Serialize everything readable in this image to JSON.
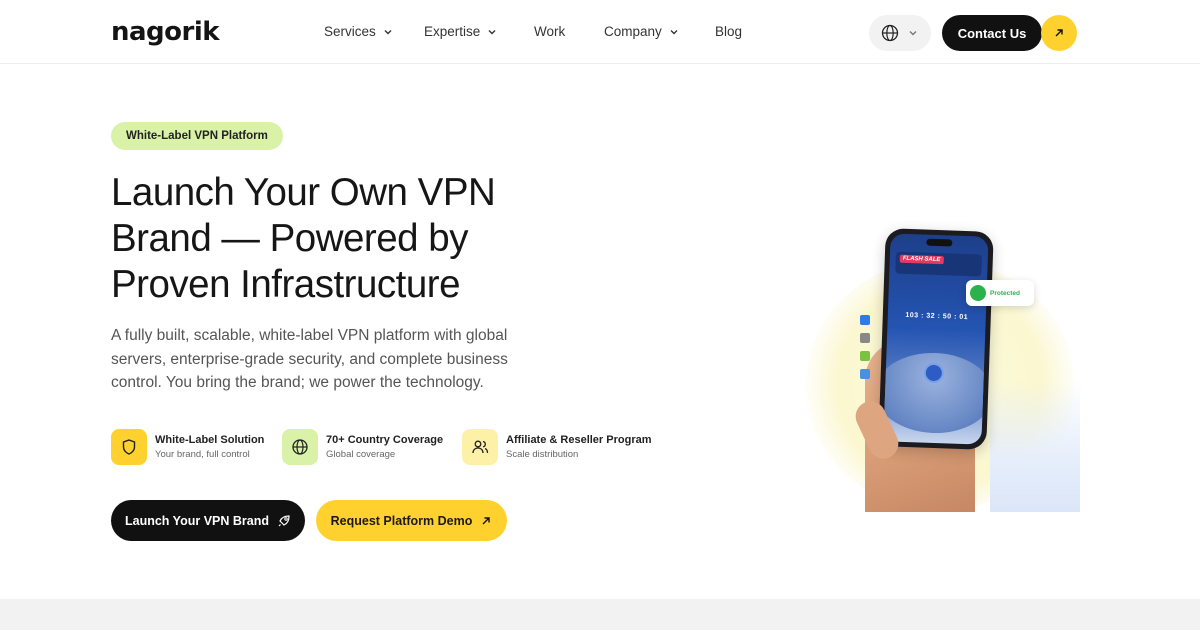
{
  "header": {
    "logo": "nagorik",
    "nav": [
      {
        "label": "Services",
        "dropdown": true
      },
      {
        "label": "Expertise",
        "dropdown": true
      },
      {
        "label": "Work",
        "dropdown": false
      },
      {
        "label": "Company",
        "dropdown": true
      },
      {
        "label": "Blog",
        "dropdown": false
      }
    ],
    "language_icon": "globe-icon",
    "contact_label": "Contact Us"
  },
  "hero": {
    "badge": "White-Label VPN Platform",
    "title": "Launch Your Own VPN Brand — Powered by Proven Infrastructure",
    "description": "A fully built, scalable, white-label VPN platform with global servers, enterprise-grade security, and complete business control. You bring the brand; we power the technology.",
    "features": [
      {
        "title": "White-Label Solution",
        "subtitle": "Your brand, full control",
        "icon": "shield-icon",
        "color": "#ffd12f"
      },
      {
        "title": "70+ Country Coverage",
        "subtitle": "Global coverage",
        "icon": "globe-icon",
        "color": "#d9f2a8"
      },
      {
        "title": "Affiliate & Reseller Program",
        "subtitle": "Scale distribution",
        "icon": "users-icon",
        "color": "#fdf1a8"
      }
    ],
    "primary_cta": "Launch Your VPN Brand",
    "secondary_cta": "Request Platform Demo",
    "phone": {
      "sale_label": "FLASH SALE",
      "timer": "103 : 32 : 50 : 01",
      "status": "Protected"
    }
  },
  "colors": {
    "accent_yellow": "#ffd12f",
    "badge_green": "#d9f2a8",
    "dark": "#111111"
  }
}
